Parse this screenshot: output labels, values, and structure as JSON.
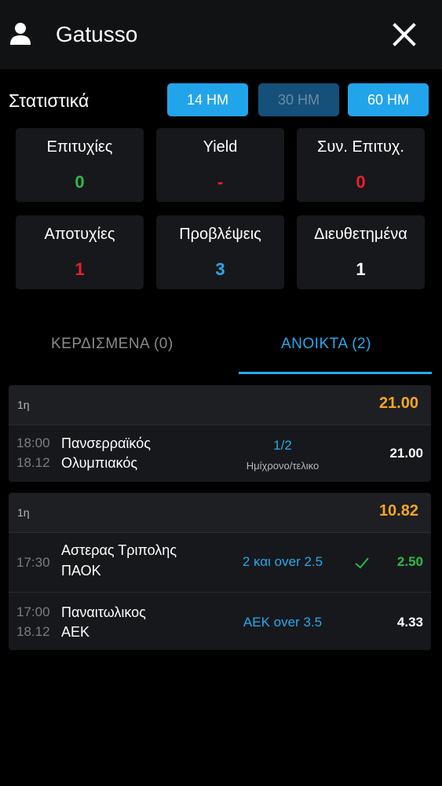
{
  "header": {
    "title": "Gatusso",
    "user_icon": "user-icon",
    "close_icon": "close-icon"
  },
  "stats": {
    "title": "Στατιστικά",
    "ranges": [
      {
        "label": "14 ΗΜ",
        "state": "active"
      },
      {
        "label": "30 ΗΜ",
        "state": "inactive"
      },
      {
        "label": "60 ΗΜ",
        "state": "active"
      }
    ],
    "cards": [
      {
        "label": "Επιτυχίες",
        "value": "0",
        "color": "#2fb84a"
      },
      {
        "label": "Yield",
        "value": "-",
        "color": "#e8202a"
      },
      {
        "label": "Συν. Επιτυχ.",
        "value": "0",
        "color": "#e8202a"
      },
      {
        "label": "Αποτυχίες",
        "value": "1",
        "color": "#e8202a"
      },
      {
        "label": "Προβλέψεις",
        "value": "3",
        "color": "#28a8ee"
      },
      {
        "label": "Διευθετημένα",
        "value": "1",
        "color": "#ffffff"
      }
    ]
  },
  "tabs": [
    {
      "label": "ΚΕΡΔΙΣΜΕΝΑ (0)",
      "selected": false
    },
    {
      "label": "ΑΝΟΙΚΤΑ (2)",
      "selected": true
    }
  ],
  "bets": [
    {
      "type": "1η",
      "total_odds": "21.00",
      "rows": [
        {
          "time": "18:00",
          "date": "18.12",
          "home": "Πανσερραϊκός",
          "away": "Ολυμπιακός",
          "pick": "1/2",
          "pick_sub": "Ημίχρονο/τελικο",
          "odds": "21.00",
          "won": false
        }
      ]
    },
    {
      "type": "1η",
      "total_odds": "10.82",
      "rows": [
        {
          "time": "17:30",
          "date": "",
          "home": "Αστερας Τριπολης",
          "away": "ΠΑΟΚ",
          "pick": "2 και over 2.5",
          "pick_sub": "",
          "odds": "2.50",
          "won": true
        },
        {
          "time": "17:00",
          "date": "18.12",
          "home": "Παναιτωλικος",
          "away": "ΑΕΚ",
          "pick": "ΑΕΚ over 3.5",
          "pick_sub": "",
          "odds": "4.33",
          "won": false
        }
      ]
    }
  ],
  "colors": {
    "accent": "#28a8ee",
    "total_odds": "#f5a623",
    "won": "#2fb84a",
    "lost": "#e8202a"
  }
}
